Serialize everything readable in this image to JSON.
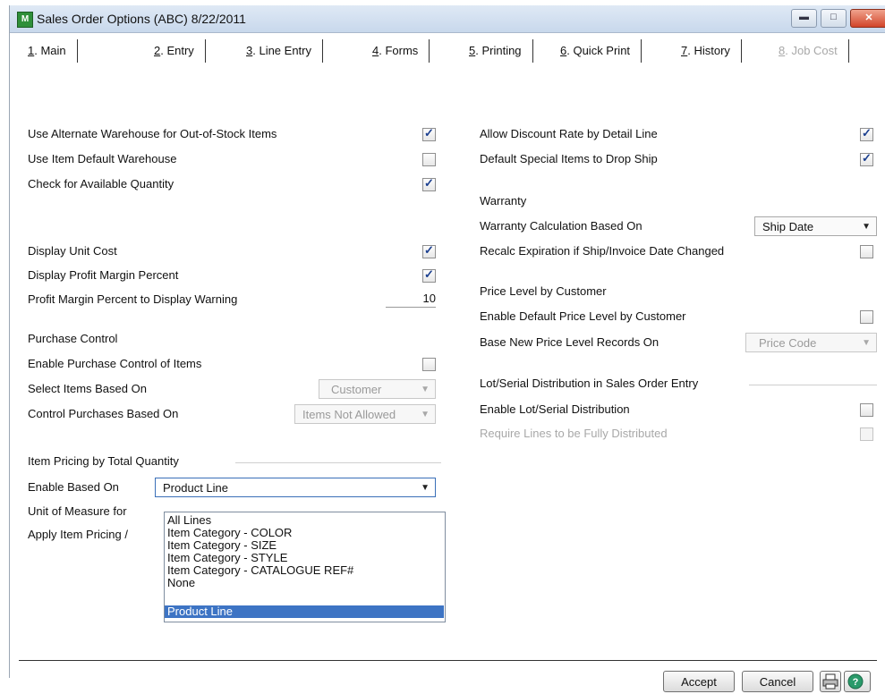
{
  "window": {
    "title": "Sales Order Options (ABC) 8/22/2011",
    "app_icon_text": "M"
  },
  "tabs": [
    {
      "label": "1. Main",
      "active": false,
      "enabled": true
    },
    {
      "label": "2. Entry",
      "active": false,
      "enabled": true
    },
    {
      "label": "3. Line Entry",
      "active": true,
      "enabled": true
    },
    {
      "label": "4. Forms",
      "active": false,
      "enabled": true
    },
    {
      "label": "5. Printing",
      "active": false,
      "enabled": true
    },
    {
      "label": "6. Quick Print",
      "active": false,
      "enabled": true
    },
    {
      "label": "7. History",
      "active": false,
      "enabled": true
    },
    {
      "label": "8. Job Cost",
      "active": false,
      "enabled": false
    }
  ],
  "left": {
    "alt_warehouse": {
      "label": "Use Alternate Warehouse for Out-of-Stock Items",
      "checked": true
    },
    "item_default_warehouse": {
      "label": "Use Item Default Warehouse",
      "checked": false
    },
    "check_available_qty": {
      "label": "Check for Available Quantity",
      "checked": true
    },
    "display_unit_cost": {
      "label": "Display Unit Cost",
      "checked": true
    },
    "display_profit_margin": {
      "label": "Display Profit Margin Percent",
      "checked": true
    },
    "profit_margin_warning": {
      "label": "Profit Margin Percent to Display Warning",
      "value": "10"
    },
    "purchase_control": {
      "heading": "Purchase Control",
      "enable_label": "Enable Purchase Control of Items",
      "enable_checked": false,
      "select_items_label": "Select Items Based On",
      "select_items_value": "Customer",
      "control_purchases_label": "Control Purchases Based On",
      "control_purchases_value": "Items Not Allowed"
    },
    "item_pricing": {
      "heading": "Item Pricing by Total Quantity",
      "enable_based_on_label": "Enable Based On",
      "enable_based_on_value": "Product Line",
      "uom_label": "Unit of Measure for",
      "apply_label": "Apply Item Pricing /",
      "options": [
        "All Lines",
        "Item Category - COLOR",
        "Item Category - SIZE",
        "Item Category - STYLE",
        "Item Category - CATALOGUE REF#",
        "None",
        "Product Line"
      ],
      "selected_option": "Product Line"
    }
  },
  "right": {
    "allow_discount_rate": {
      "label": "Allow Discount Rate by Detail Line",
      "checked": true
    },
    "drop_ship": {
      "label": "Default Special Items to Drop Ship",
      "checked": true
    },
    "warranty": {
      "heading": "Warranty",
      "calc_label": "Warranty Calculation Based On",
      "calc_value": "Ship Date",
      "recalc_label": "Recalc Expiration if Ship/Invoice Date Changed",
      "recalc_checked": false
    },
    "price_level": {
      "heading": "Price Level by Customer",
      "enable_label": "Enable Default Price Level by Customer",
      "enable_checked": false,
      "base_label": "Base New Price Level Records On",
      "base_value": "Price Code"
    },
    "lot_serial": {
      "heading": "Lot/Serial Distribution in Sales Order Entry",
      "enable_label": "Enable Lot/Serial Distribution",
      "enable_checked": false,
      "require_label": "Require Lines to be Fully Distributed",
      "require_checked": false
    }
  },
  "footer": {
    "accept": "Accept",
    "cancel": "Cancel"
  },
  "icons": {
    "minimize": "minimize-icon",
    "maximize": "maximize-icon",
    "close": "close-icon",
    "print": "printer-icon",
    "help": "help-icon"
  }
}
